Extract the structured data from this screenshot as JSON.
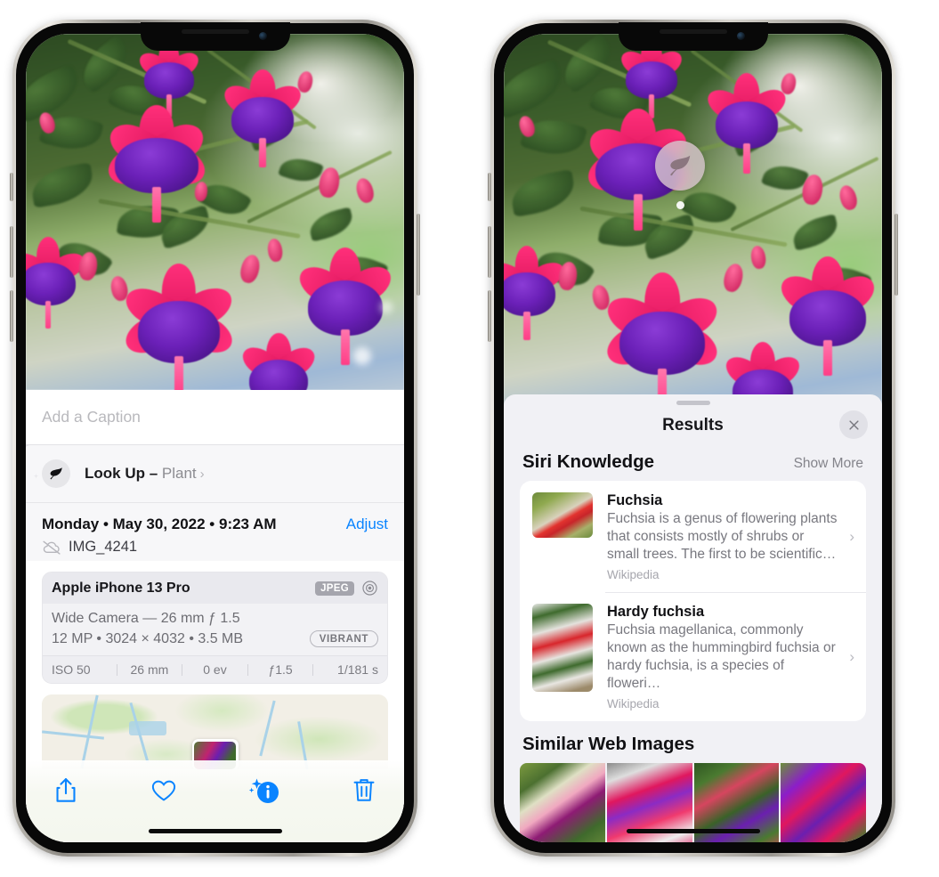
{
  "left_phone": {
    "name": "photo-detail-screen",
    "caption_field": {
      "placeholder": "Add a Caption",
      "value": ""
    },
    "lookup_row": {
      "icon": "leaf-icon",
      "label": "Look Up – ",
      "subject": "Plant",
      "chevron": "›"
    },
    "meta": {
      "date_line": "Monday • May 30, 2022 • 9:23 AM",
      "adjust_label": "Adjust",
      "cloud_icon": "icloud-slash-icon",
      "filename": "IMG_4241"
    },
    "camera_card": {
      "model": "Apple iPhone 13 Pro",
      "format_chip": "JPEG",
      "aperture_icon": "aperture-icon",
      "lens": "Wide Camera — 26 mm ƒ 1.5",
      "specs": "12 MP • 3024 × 4032 • 3.5 MB",
      "profile_chip": "VIBRANT",
      "exif": [
        "ISO 50",
        "26 mm",
        "0 ev",
        "ƒ1.5",
        "1/181 s"
      ]
    },
    "map": {
      "name": "location-map-thumbnail"
    },
    "toolbar": {
      "share": "share-icon",
      "favorite": "heart-icon",
      "info": "info-sparkle-icon",
      "delete": "trash-icon"
    }
  },
  "right_phone": {
    "name": "visual-lookup-results-screen",
    "photo_badge": {
      "icon": "leaf-icon",
      "name": "visual-lookup-badge"
    },
    "sheet": {
      "title": "Results",
      "close_label": "✕",
      "sections": [
        {
          "title": "Siri Knowledge",
          "action": "Show More",
          "items": [
            {
              "title": "Fuchsia",
              "description": "Fuchsia is a genus of flowering plants that consists mostly of shrubs or small trees. The first to be scientific…",
              "source": "Wikipedia",
              "chevron": "›"
            },
            {
              "title": "Hardy fuchsia",
              "description": "Fuchsia magellanica, commonly known as the hummingbird fuchsia or hardy fuchsia, is a species of floweri…",
              "source": "Wikipedia",
              "chevron": "›"
            }
          ]
        },
        {
          "title": "Similar Web Images",
          "thumbnails": [
            "web-image-1",
            "web-image-2",
            "web-image-3",
            "web-image-4"
          ]
        }
      ]
    }
  },
  "colors": {
    "accent_blue": "#0a84ff",
    "sheet_gray": "#f1f1f5",
    "text_primary": "#111114",
    "text_secondary": "#78787f"
  }
}
